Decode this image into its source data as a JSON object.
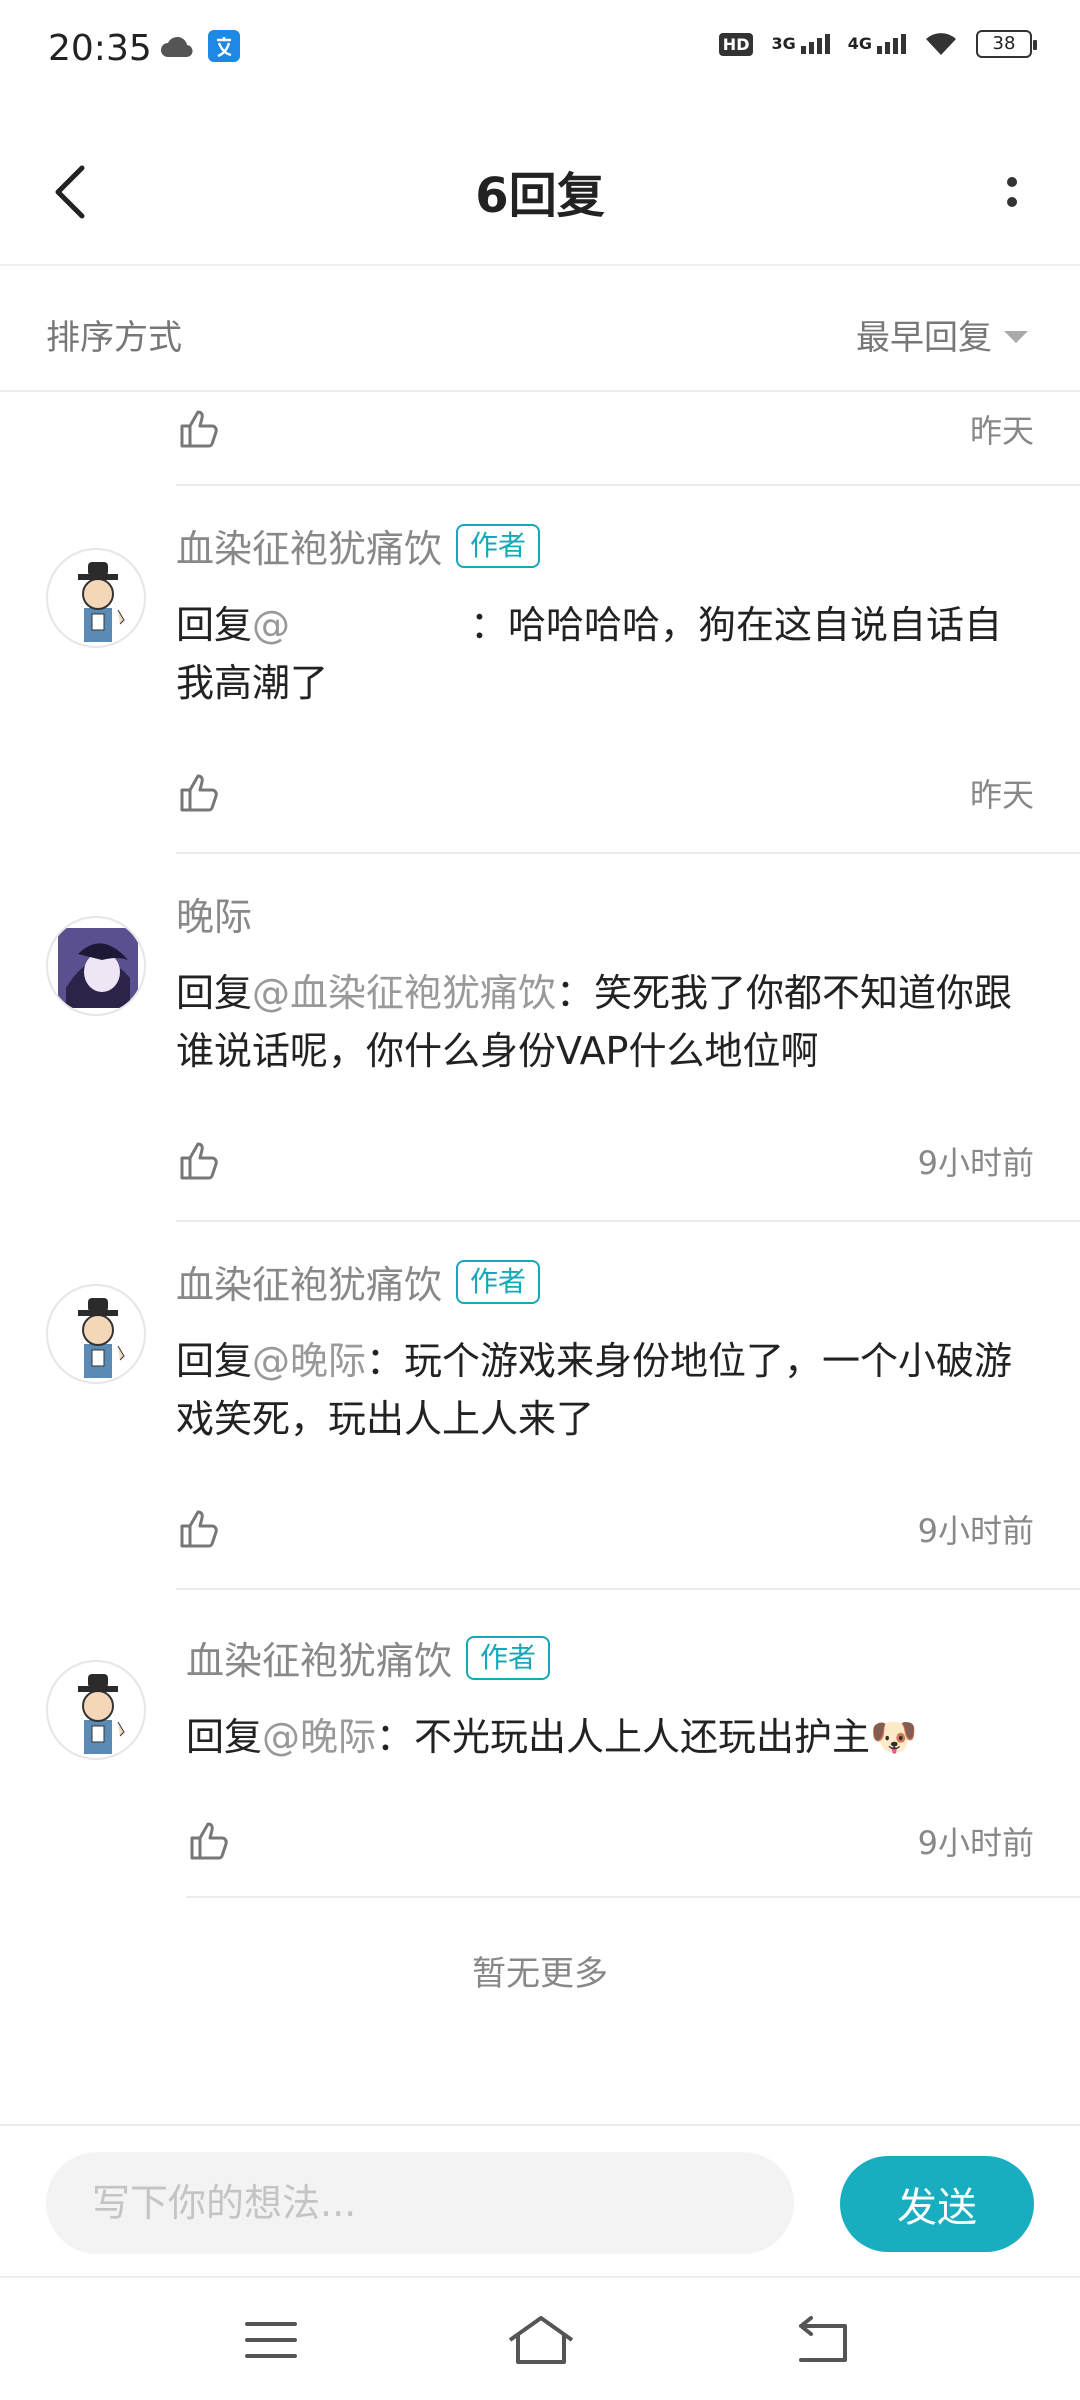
{
  "status_bar": {
    "time": "20:35",
    "network_hd": "HD",
    "network_3g": "3G",
    "network_4g": "4G",
    "battery": "38"
  },
  "header": {
    "title": "6回复"
  },
  "sort": {
    "label": "排序方式",
    "value": "最早回复"
  },
  "replies": [
    {
      "time": "昨天"
    },
    {
      "name": "血染征袍犹痛饮",
      "badge": "作者",
      "prefix": "回复",
      "mention": "@",
      "text": "：哈哈哈哈，狗在这自说自话自我高潮了",
      "time": "昨天"
    },
    {
      "name": "晚际",
      "badge": "",
      "prefix": "回复",
      "mention": "@血染征袍犹痛饮",
      "text": "：笑死我了你都不知道你跟谁说话呢，你什么身份VAP什么地位啊",
      "time": "9小时前"
    },
    {
      "name": "血染征袍犹痛饮",
      "badge": "作者",
      "prefix": "回复",
      "mention": "@晚际",
      "text": "：玩个游戏来身份地位了，一个小破游戏笑死，玩出人上人来了",
      "time": "9小时前"
    },
    {
      "name": "血染征袍犹痛饮",
      "badge": "作者",
      "prefix": "回复",
      "mention": "@晚际",
      "text": "：不光玩出人上人还玩出护主🐶",
      "time": "9小时前"
    }
  ],
  "footer_text": "暂无更多",
  "input": {
    "placeholder": "写下你的想法...",
    "send_label": "发送"
  },
  "colors": {
    "accent": "#19adc0",
    "badge": "#17a8b8",
    "muted_text": "#888888"
  }
}
